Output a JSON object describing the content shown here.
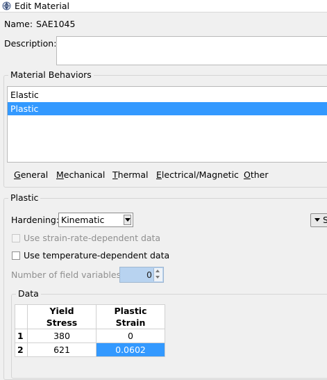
{
  "window": {
    "title": "Edit Material"
  },
  "name": {
    "label": "Name:",
    "value": "SAE1045"
  },
  "description": {
    "label": "Description:",
    "value": ""
  },
  "material_behaviors": {
    "group_title": "Material Behaviors",
    "items": [
      {
        "label": "Elastic",
        "selected": false
      },
      {
        "label": "Plastic",
        "selected": true
      }
    ]
  },
  "menu": {
    "general": {
      "u": "G",
      "rest": "eneral"
    },
    "mechanical": {
      "u": "M",
      "rest": "echanical"
    },
    "thermal": {
      "u": "T",
      "rest": "hermal"
    },
    "electrical": {
      "u": "E",
      "rest": "lectrical/Magnetic"
    },
    "other": {
      "u": "O",
      "rest": "ther"
    }
  },
  "plastic": {
    "group_title": "Plastic",
    "hardening_label": "Hardening:",
    "hardening_value": "Kinematic",
    "side_button_label": "S",
    "strain_rate_label": "Use strain-rate-dependent data",
    "temperature_label": "Use temperature-dependent data",
    "field_vars_label": "Number of field variables:",
    "field_vars_value": "0"
  },
  "data_table": {
    "group_title": "Data",
    "headers": [
      {
        "line1": "Yield",
        "line2": "Stress"
      },
      {
        "line1": "Plastic",
        "line2": "Strain"
      }
    ],
    "rows": [
      {
        "index": "1",
        "yield_stress": "380",
        "plastic_strain": "0"
      },
      {
        "index": "2",
        "yield_stress": "621",
        "plastic_strain": "0.0602"
      }
    ]
  },
  "colors": {
    "selection": "#3399ff",
    "spinner_bg": "#b8d3f0",
    "window_bg": "#f0f0f0"
  }
}
